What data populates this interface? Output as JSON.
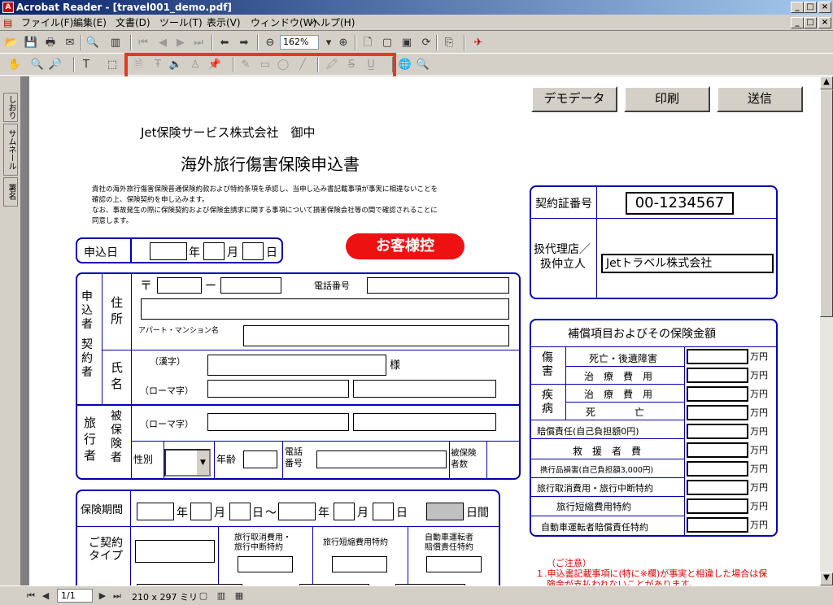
{
  "window": {
    "title": "Acrobat Reader - [travel001_demo.pdf]",
    "icon": "acrobat-icon"
  },
  "menu": [
    "ファイル(F)",
    "編集(E)",
    "文書(D)",
    "ツール(T)",
    "表示(V)",
    "ウィンドウ(W)",
    "ヘルプ(H)"
  ],
  "toolbar": {
    "zoom": "162%"
  },
  "status": {
    "page": "1/1",
    "size": "210 x 297 ミリ"
  },
  "sidetabs": [
    "しおり",
    "サムネール",
    "署名"
  ],
  "buttons": {
    "demo": "デモデータ",
    "print": "印刷",
    "send": "送信"
  },
  "form": {
    "company": "Jet保険サービス株式会社　御中",
    "title": "海外旅行傷害保険申込書",
    "intro": [
      "貴社の海外旅行傷害保険普通保険約款および特約条項を承認し、当申し込み書記載事項が事実に相違ないことを",
      "確認の上、保険契約を申し込みます。",
      "なお、事故発生の際に保険契約および保険金請求に関する事項について損害保険会社等の間で確認されることに",
      "同意します。"
    ],
    "stamp": "お客様控",
    "date": {
      "label": "申込日",
      "year": "年",
      "month": "月",
      "day": "日"
    },
    "applicant": {
      "side": "申込者",
      "side2": "契約者",
      "addr": "住所",
      "postal": "〒",
      "dash": "ー",
      "phone": "電話番号",
      "apt": "アパート・マンション名",
      "name": "氏名",
      "kanji": "（漢字）",
      "sama": "様",
      "roman": "（ローマ字）"
    },
    "insured": {
      "side": "旅行者",
      "side2": "被保険者",
      "roman": "（ローマ字）",
      "gender": "性別",
      "age": "年齢",
      "phone": "電話番号",
      "count": "被保険者数"
    },
    "period": {
      "label": "保険期間",
      "year": "年",
      "month": "月",
      "day": "日",
      "tilde": "～",
      "days": "日間"
    },
    "contract": {
      "label": "ご契約タイプ",
      "c1": "旅行取消費用・",
      "c1b": "旅行中断特約",
      "c2": "旅行短縮費用特約",
      "c3": "自動車運転者",
      "c3b": "賠償責任特約"
    },
    "policy": {
      "label": "契約証番号",
      "number": "00-1234567",
      "agent": "扱代理店／",
      "agent2": "扱仲立人",
      "agentname": "Jetトラベル株式会社"
    },
    "coverage": {
      "header": "補償項目およびその保険金額",
      "injury": "傷害",
      "illness": "疾病",
      "unit": "万円",
      "rows": [
        "死亡・後遺障害",
        "治　療　費　用",
        "治　療　費　用",
        "死　　　　亡",
        "賠償責任(自己負担額0円)",
        "救　援　者　費",
        "携行品損害(自己負担額3,000円)",
        "旅行取消費用・旅行中断特約",
        "旅行短縮費用特約",
        "自動車運転者賠償責任特約"
      ]
    },
    "notes": {
      "head": "（ご注意）",
      "line1": "１.申込書記載事項に(特に※欄)が事実と相違した場合は保",
      "line2": "険金が支払われないことがあります。"
    }
  }
}
